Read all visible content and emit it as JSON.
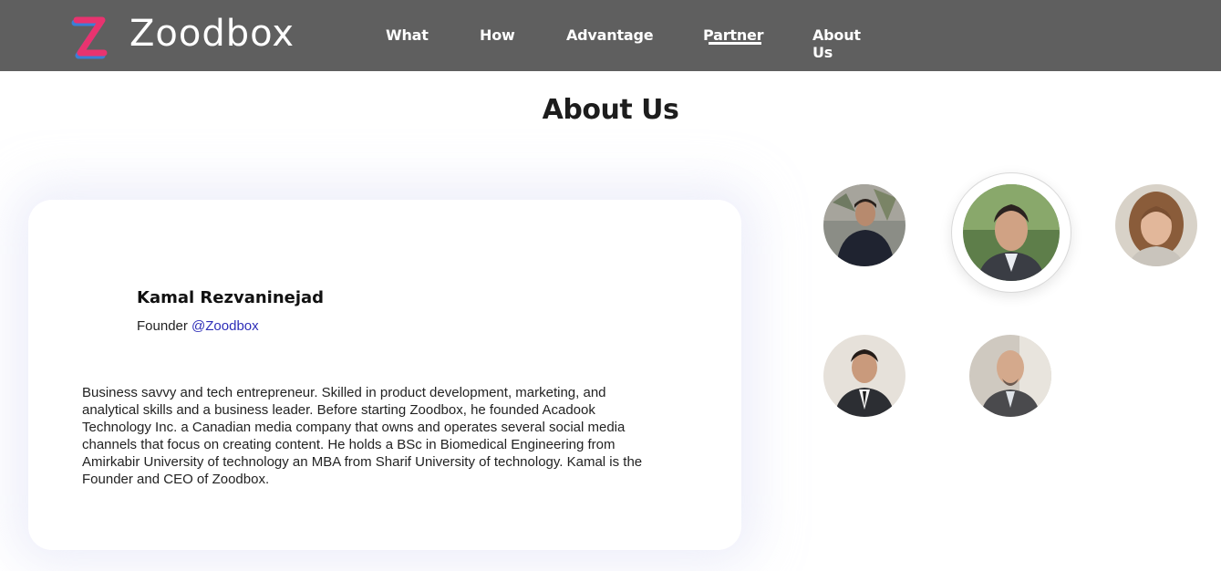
{
  "header": {
    "brand": "Zoodbox",
    "nav": [
      "What",
      "How",
      "Advantage",
      "Partner",
      "About Us"
    ],
    "active_nav": "Partner",
    "background": "#5f5f5f"
  },
  "about": {
    "title": "About Us",
    "selected_member": {
      "name": "Kamal Rezvaninejad",
      "role": "Founder",
      "handle": "@Zoodbox",
      "bio": "Business savvy and tech entrepreneur. Skilled in product development, marketing, and analytical skills and a business leader. Before starting Zoodbox, he founded Acadook Technology Inc. a Canadian media company that owns and operates several social media channels that focus on creating content. He holds a BSc in Biomedical Engineering from Amirkabir University of technology an MBA from Sharif University of technology. Kamal is the Founder and CEO of Zoodbox."
    },
    "team_avatars": [
      "team-member-photo",
      "team-member-photo-selected",
      "team-member-photo",
      "team-member-photo",
      "team-member-photo"
    ]
  },
  "colors": {
    "link": "#2d2db8",
    "logo_pink": "#e8336f",
    "logo_blue": "#3a7fd6"
  }
}
